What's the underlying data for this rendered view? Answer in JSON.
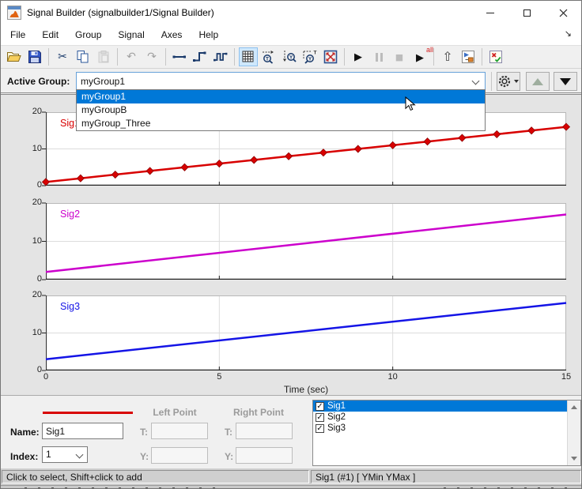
{
  "window": {
    "title": "Signal Builder (signalbuilder1/Signal Builder)"
  },
  "menu": {
    "items": [
      "File",
      "Edit",
      "Group",
      "Signal",
      "Axes",
      "Help"
    ]
  },
  "toolbar": {
    "run_all_label": "all",
    "buttons": [
      "open",
      "save",
      "cut",
      "copy",
      "paste",
      "undo",
      "redo",
      "draw-line",
      "draw-step",
      "draw-pulse",
      "snap-to-grid",
      "zoom-time",
      "zoom-y",
      "zoom-time-y",
      "fit-to-view",
      "start-simulation",
      "pause-simulation",
      "stop-simulation",
      "run-all",
      "up-to-parent",
      "go-to-signal-builder-block",
      "simulation-output-options"
    ],
    "snap_to_grid_active": true,
    "disabled_buttons": [
      "paste",
      "undo",
      "redo",
      "pause-simulation",
      "stop-simulation"
    ]
  },
  "active_group": {
    "label": "Active Group:",
    "value": "myGroup1",
    "options": [
      "myGroup1",
      "myGroupB",
      "myGroup_Three"
    ],
    "selected_index": 0
  },
  "chart_data": {
    "type": "line",
    "xlabel": "Time (sec)",
    "xlim": [
      0,
      15
    ],
    "ylim": [
      0,
      20
    ],
    "x_ticks": [
      0,
      5,
      10,
      15
    ],
    "y_ticks": [
      0,
      10,
      20
    ],
    "grid": true,
    "series": [
      {
        "name": "Sig1",
        "color": "#d80000",
        "marker": "diamond",
        "x": [
          0,
          1,
          2,
          3,
          4,
          5,
          6,
          7,
          8,
          9,
          10,
          11,
          12,
          13,
          14,
          15
        ],
        "y": [
          1,
          2,
          3,
          4,
          5,
          6,
          7,
          8,
          9,
          10,
          11,
          12,
          13,
          14,
          15,
          16
        ]
      },
      {
        "name": "Sig2",
        "color": "#cc00cc",
        "marker": "none",
        "x": [
          0,
          15
        ],
        "y": [
          2,
          17
        ]
      },
      {
        "name": "Sig3",
        "color": "#1414e6",
        "marker": "none",
        "x": [
          0,
          15
        ],
        "y": [
          3,
          18
        ]
      }
    ]
  },
  "editor": {
    "selected_signal_color": "#d80000",
    "left_point_label": "Left Point",
    "right_point_label": "Right Point",
    "name_label": "Name:",
    "name_value": "Sig1",
    "index_label": "Index:",
    "index_value": "1",
    "t_label": "T:",
    "y_label": "Y:",
    "left_t_value": "",
    "left_y_value": "",
    "right_t_value": "",
    "right_y_value": ""
  },
  "signal_list": {
    "items": [
      {
        "label": "Sig1",
        "checked": true,
        "selected": true
      },
      {
        "label": "Sig2",
        "checked": true,
        "selected": false
      },
      {
        "label": "Sig3",
        "checked": true,
        "selected": false
      }
    ]
  },
  "status_bar": {
    "left": "Click to select, Shift+click to add",
    "right": "Sig1 (#1)  [ YMin YMax ]"
  }
}
